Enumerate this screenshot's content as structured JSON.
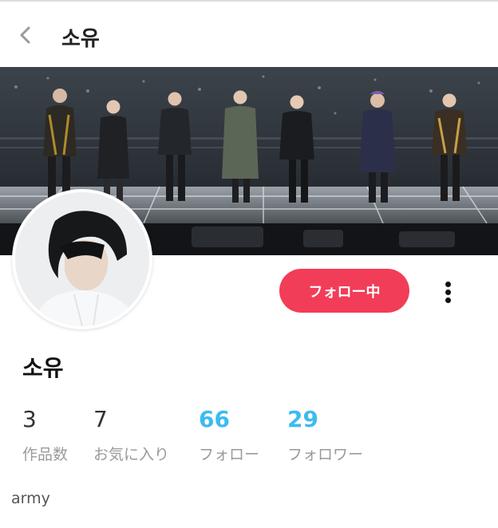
{
  "header": {
    "title": "소유",
    "back_icon": "chevron-left-icon"
  },
  "cover": {
    "description_icon": "concert-stage-photo"
  },
  "profile": {
    "name": "소유",
    "follow_button": "フォロー中",
    "more_icon": "more-vertical-icon",
    "bio": "army"
  },
  "stats": [
    {
      "value": "3",
      "label": "作品数"
    },
    {
      "value": "7",
      "label": "お気に入り"
    },
    {
      "value": "66",
      "label": "フォロー"
    },
    {
      "value": "29",
      "label": "フォロワー"
    }
  ],
  "colors": {
    "accent_red": "#f23d58",
    "accent_blue": "#3dbbf0"
  }
}
